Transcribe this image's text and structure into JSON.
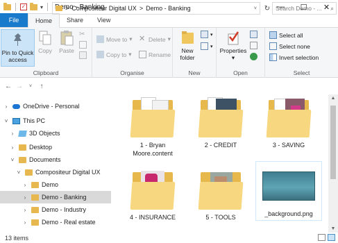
{
  "window": {
    "title": "Demo - Banking",
    "controls": {
      "minimize": "—",
      "maximize": "☐",
      "close": "✕"
    }
  },
  "ribbon_tabs": [
    "File",
    "Home",
    "Share",
    "View"
  ],
  "ribbon": {
    "clipboard": {
      "label": "Clipboard",
      "pin_line1": "Pin to Quick",
      "pin_line2": "access",
      "copy": "Copy",
      "paste": "Paste"
    },
    "organise": {
      "label": "Organise",
      "move_to": "Move to",
      "copy_to": "Copy to",
      "delete": "Delete",
      "rename": "Rename"
    },
    "new": {
      "label": "New",
      "new_folder_line1": "New",
      "new_folder_line2": "folder"
    },
    "open": {
      "label": "Open",
      "properties": "Properties"
    },
    "select": {
      "label": "Select",
      "select_all": "Select all",
      "select_none": "Select none",
      "invert_selection": "Invert selection"
    }
  },
  "address": {
    "segments": [
      "Compositeur Digital UX",
      "Demo - Banking"
    ],
    "separator": ">",
    "search_placeholder": "Search Demo - ..."
  },
  "tree": [
    {
      "label": "OneDrive - Personal",
      "chevron": "›",
      "icon": "cloud-icon",
      "indent": 0
    },
    {
      "label": "This PC",
      "chevron": "˅",
      "icon": "computer-icon",
      "indent": 0
    },
    {
      "label": "3D Objects",
      "chevron": "›",
      "icon": "3d-objects-icon",
      "indent": 1
    },
    {
      "label": "Desktop",
      "chevron": "›",
      "icon": "folder-icon",
      "indent": 1
    },
    {
      "label": "Documents",
      "chevron": "˅",
      "icon": "folder-icon",
      "indent": 1
    },
    {
      "label": "Compositeur Digital UX",
      "chevron": "˅",
      "icon": "folder-icon",
      "indent": 2
    },
    {
      "label": "Demo",
      "chevron": "›",
      "icon": "folder-icon",
      "indent": 3
    },
    {
      "label": "Demo - Banking",
      "chevron": "›",
      "icon": "folder-icon",
      "indent": 3,
      "selected": true
    },
    {
      "label": "Demo - Industry",
      "chevron": "›",
      "icon": "folder-icon",
      "indent": 3
    },
    {
      "label": "Demo - Real estate",
      "chevron": "›",
      "icon": "folder-icon",
      "indent": 3
    }
  ],
  "files": [
    {
      "name": "1 - Bryan Moore.content",
      "type": "folder",
      "preview": "documents"
    },
    {
      "name": "2 - CREDIT",
      "type": "folder",
      "preview": "dark-card"
    },
    {
      "name": "3 - SAVING",
      "type": "folder",
      "preview": "pink-card"
    },
    {
      "name": "4 - INSURANCE",
      "type": "folder",
      "preview": "pink-photo"
    },
    {
      "name": "5 - TOOLS",
      "type": "folder",
      "preview": "photo"
    },
    {
      "name": "_background.png",
      "type": "image",
      "preview": "teal-gradient"
    }
  ],
  "status": {
    "item_count": "13 items"
  },
  "colors": {
    "accent": "#1979ca",
    "folder_back": "#e7b94d",
    "folder_front": "#f7d77f",
    "selection": "#d9d9d9",
    "ribbon_bg": "#f5f6f7"
  }
}
